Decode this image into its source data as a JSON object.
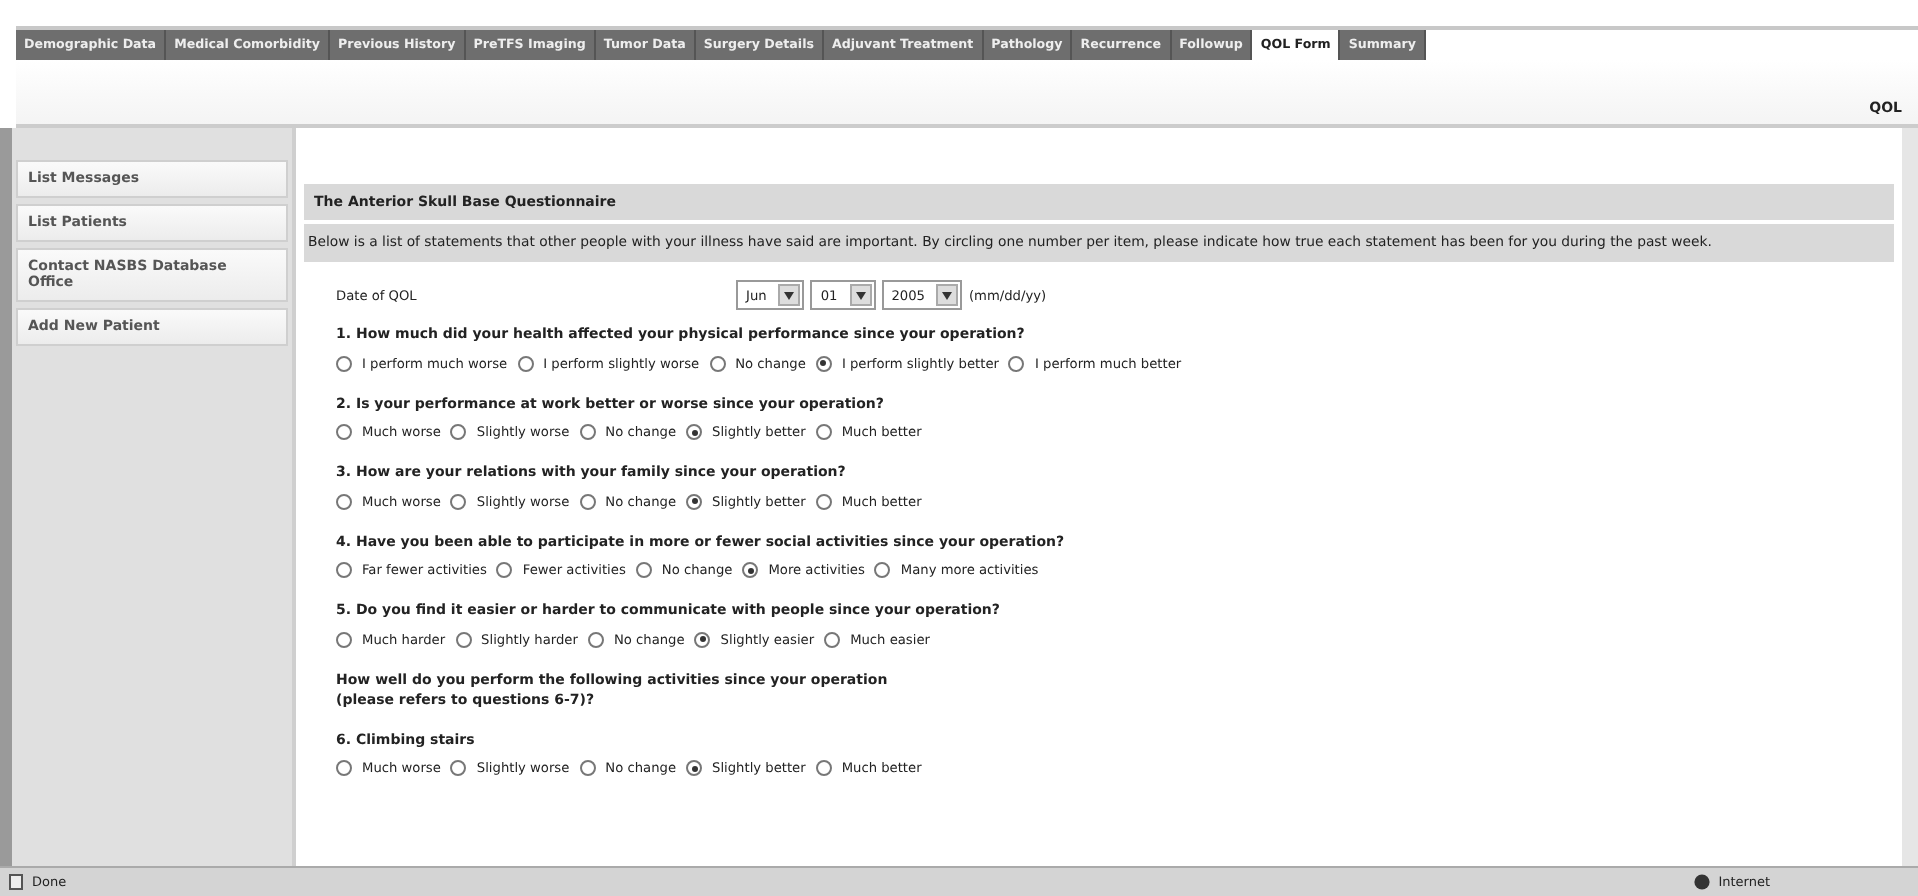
{
  "tabs": [
    {
      "label": "Demographic Data",
      "selected": false
    },
    {
      "label": "Medical Comorbidity",
      "selected": false
    },
    {
      "label": "Previous History",
      "selected": false
    },
    {
      "label": "PreTFS Imaging",
      "selected": false
    },
    {
      "label": "Tumor Data",
      "selected": false
    },
    {
      "label": "Surgery Details",
      "selected": false
    },
    {
      "label": "Adjuvant Treatment",
      "selected": false
    },
    {
      "label": "Pathology",
      "selected": false
    },
    {
      "label": "Recurrence",
      "selected": false
    },
    {
      "label": "Followup",
      "selected": false
    },
    {
      "label": "QOL Form",
      "selected": true
    },
    {
      "label": "Summary",
      "selected": false
    }
  ],
  "page_title": "QOL",
  "sidebar": {
    "items": [
      "List Messages",
      "List Patients",
      "Contact NASBS Database Office",
      "Add New Patient"
    ]
  },
  "form": {
    "title": "The Anterior Skull Base Questionnaire",
    "intro": "Below is a list of statements that other people with your illness have said are important. By circling one number per item, please indicate how true each statement has been for you during the past week.",
    "date": {
      "label": "Date of QOL",
      "month": "Jun",
      "day": "01",
      "year": "2005",
      "hint": "(mm/dd/yy)"
    },
    "items": [
      {
        "kind": "question",
        "text": "1.  How much did your health affected your physical performance since your operation?",
        "options": [
          {
            "label": "I perform much worse",
            "selected": false
          },
          {
            "label": "I perform slightly worse",
            "selected": false
          },
          {
            "label": "No change",
            "selected": false
          },
          {
            "label": "I perform slightly better",
            "selected": true
          },
          {
            "label": "I perform much better",
            "selected": false
          }
        ]
      },
      {
        "kind": "question",
        "text": "2. Is your performance at work better or worse since your operation?",
        "options": [
          {
            "label": "Much worse",
            "selected": false
          },
          {
            "label": "Slightly worse",
            "selected": false
          },
          {
            "label": "No change",
            "selected": false
          },
          {
            "label": "Slightly better",
            "selected": true
          },
          {
            "label": "Much better",
            "selected": false
          }
        ]
      },
      {
        "kind": "question",
        "text": "3.  How are your relations with your family since your operation?",
        "options": [
          {
            "label": "Much worse",
            "selected": false
          },
          {
            "label": "Slightly worse",
            "selected": false
          },
          {
            "label": "No change",
            "selected": false
          },
          {
            "label": "Slightly better",
            "selected": true
          },
          {
            "label": "Much better",
            "selected": false
          }
        ]
      },
      {
        "kind": "question",
        "text": "4. Have you been able to participate in more or fewer social activities since your operation?",
        "options": [
          {
            "label": "Far fewer activities",
            "selected": false
          },
          {
            "label": "Fewer activities",
            "selected": false
          },
          {
            "label": "No change",
            "selected": false
          },
          {
            "label": "More activities",
            "selected": true
          },
          {
            "label": "Many more activities",
            "selected": false
          }
        ]
      },
      {
        "kind": "question",
        "text": "5. Do you find it easier or harder to communicate with people since your operation?",
        "options": [
          {
            "label": "Much harder",
            "selected": false
          },
          {
            "label": "Slightly harder",
            "selected": false
          },
          {
            "label": "No change",
            "selected": false
          },
          {
            "label": "Slightly easier",
            "selected": true
          },
          {
            "label": "Much easier",
            "selected": false
          }
        ]
      },
      {
        "kind": "heading",
        "text": "How well do you perform the following activities since your operation\n(please refers to questions 6-7)?"
      },
      {
        "kind": "question",
        "text": "6. Climbing stairs",
        "options": [
          {
            "label": "Much worse",
            "selected": false
          },
          {
            "label": "Slightly worse",
            "selected": false
          },
          {
            "label": "No change",
            "selected": false
          },
          {
            "label": "Slightly better",
            "selected": true
          },
          {
            "label": "Much better",
            "selected": false
          }
        ]
      }
    ]
  },
  "status_bar": {
    "left": "Done",
    "right": "Internet"
  }
}
